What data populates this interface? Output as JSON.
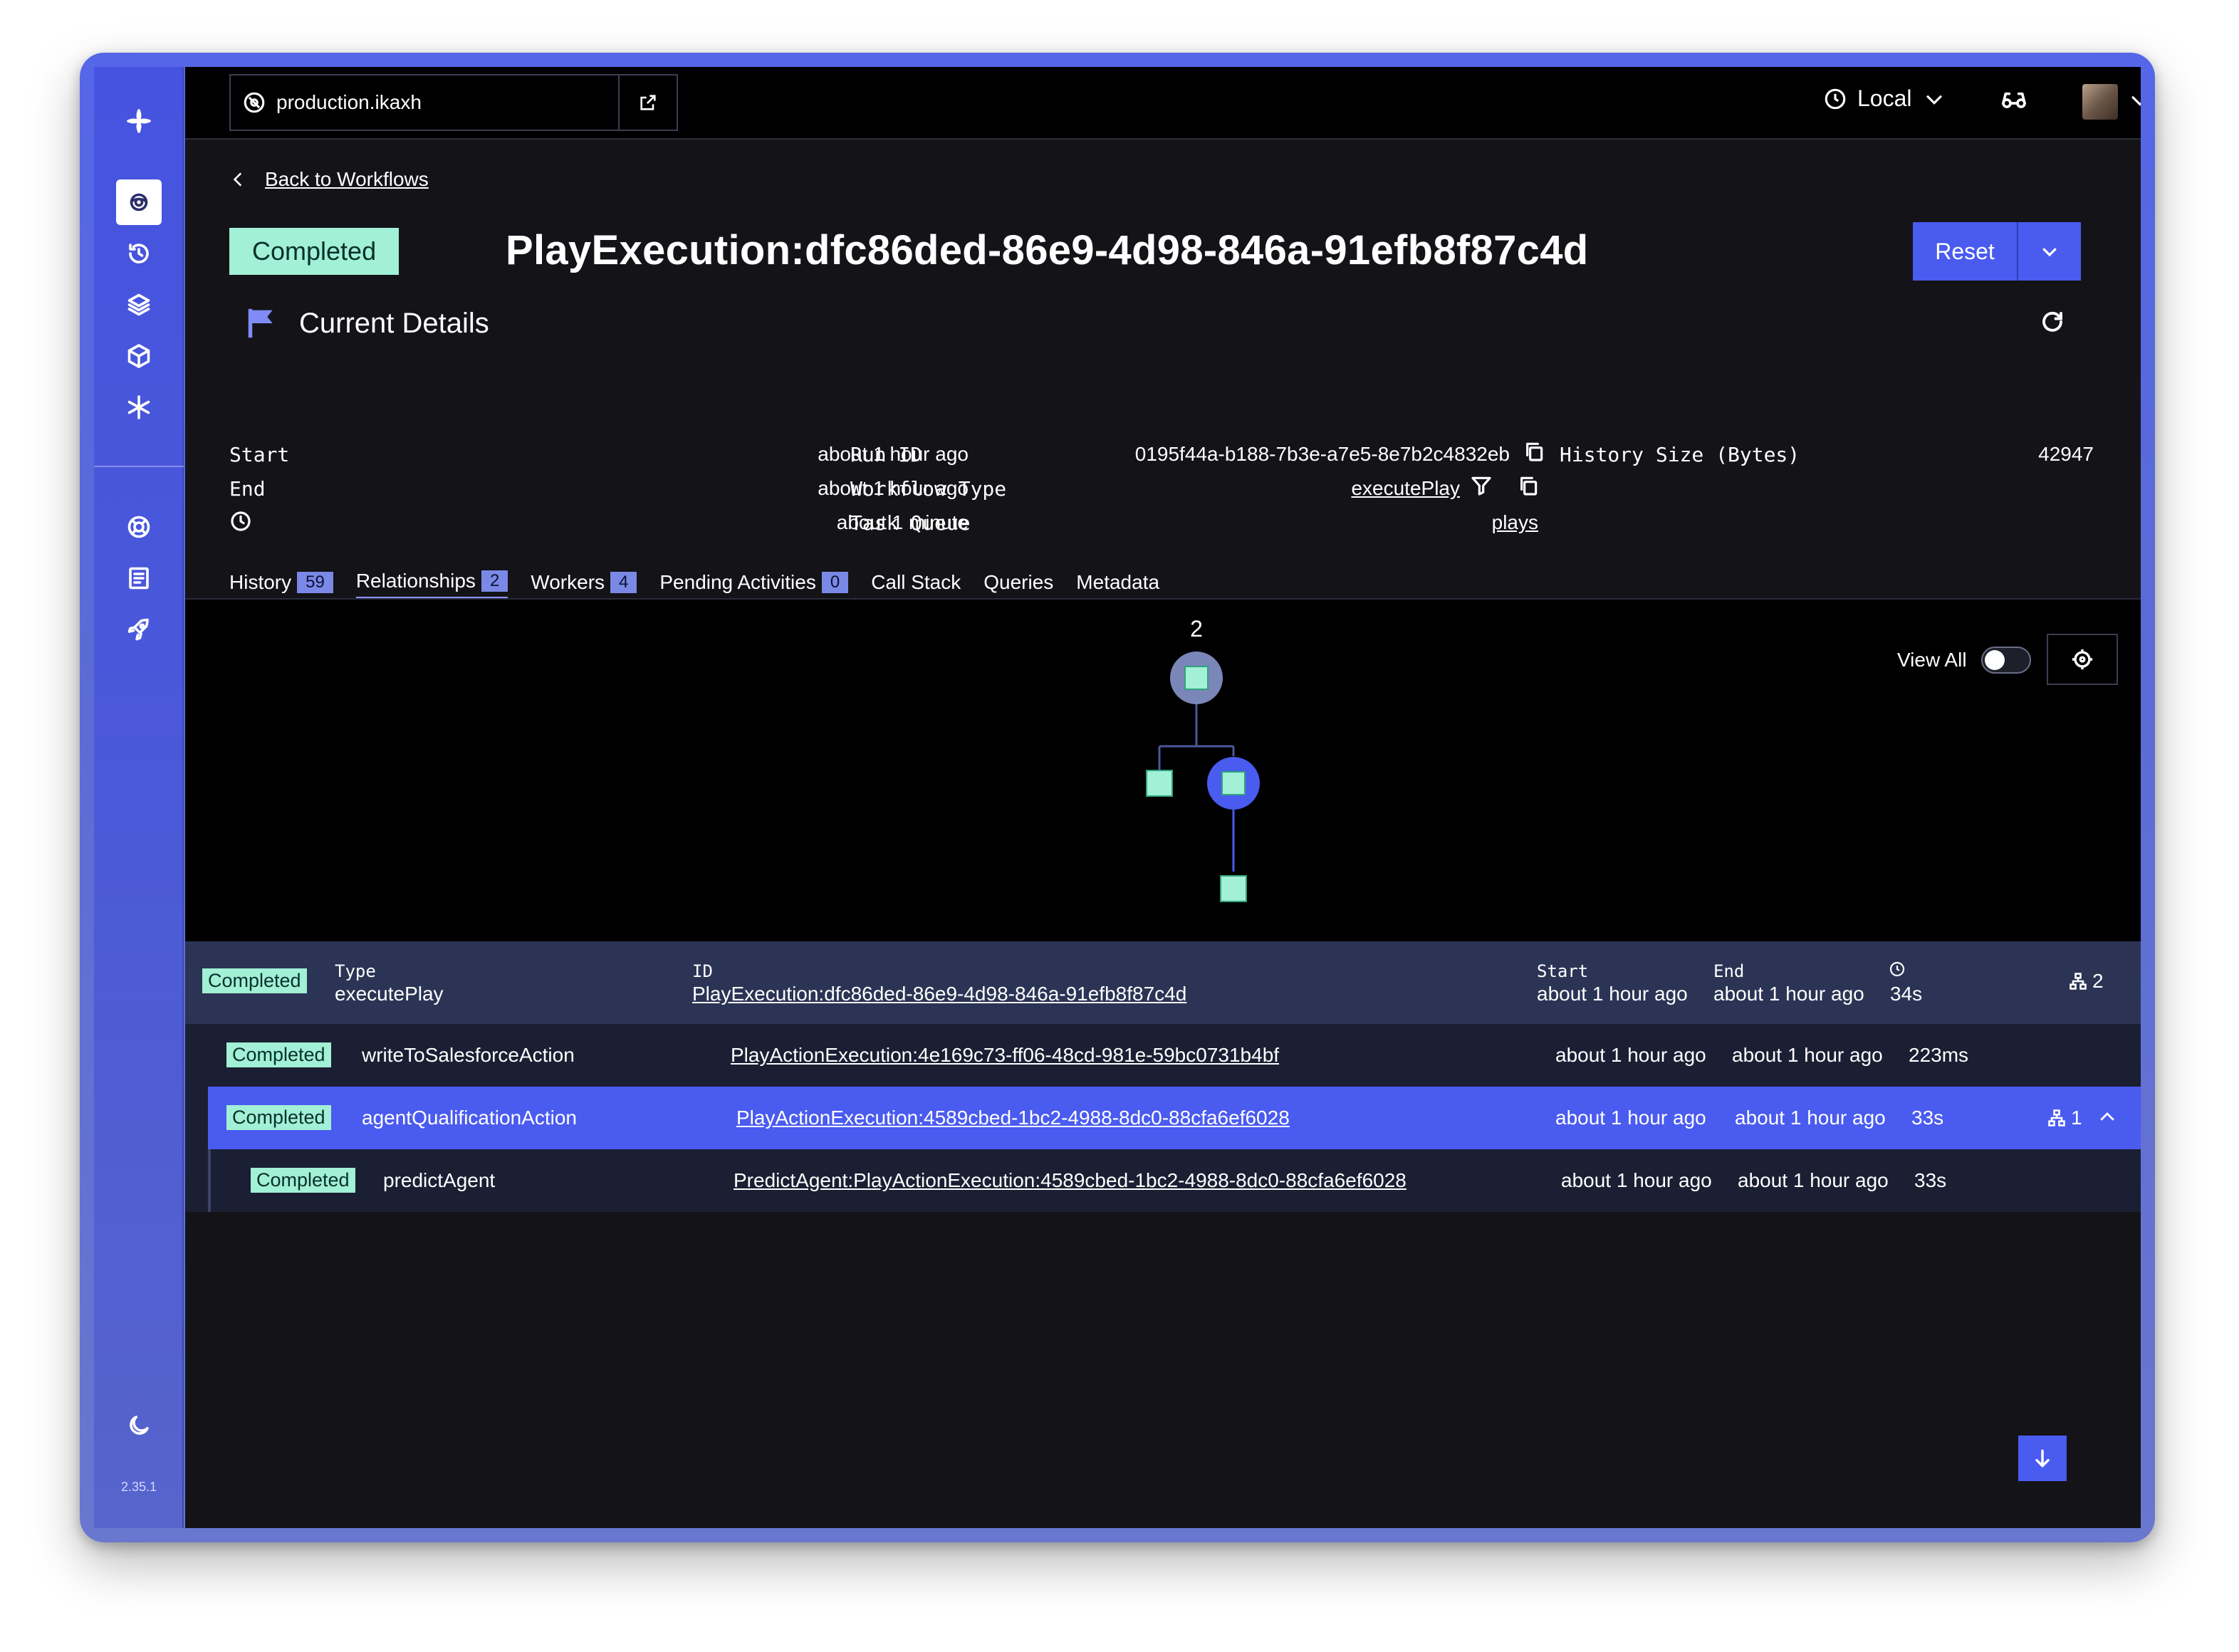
{
  "app": {
    "version": "2.35.1"
  },
  "sidebar": {
    "items": [
      {
        "name": "logo-icon"
      },
      {
        "name": "workflows-icon",
        "active": true
      },
      {
        "name": "schedules-icon"
      },
      {
        "name": "batch-icon"
      },
      {
        "name": "deployments-icon"
      },
      {
        "name": "nexus-icon"
      },
      {
        "name": "support-icon"
      },
      {
        "name": "docs-icon"
      },
      {
        "name": "feedback-icon"
      },
      {
        "name": "theme-moon-icon"
      }
    ]
  },
  "topbar": {
    "namespace": "production.ikaxh",
    "timezone": "Local"
  },
  "header": {
    "back_label": "Back to Workflows",
    "status": "Completed",
    "title": "PlayExecution:dfc86ded-86e9-4d98-846a-91efb8f87c4d",
    "reset_label": "Reset",
    "section_title": "Current Details"
  },
  "details": {
    "start_label": "Start",
    "start_value": "about 1 hour ago",
    "end_label": "End",
    "end_value": "about 1 hour ago",
    "duration_value": "about 1 minute",
    "run_id_label": "Run ID",
    "run_id_value": "0195f44a-b188-7b3e-a7e5-8e7b2c4832eb",
    "workflow_type_label": "Workflow Type",
    "workflow_type_value": "executePlay",
    "task_queue_label": "Task Queue",
    "task_queue_value": "plays",
    "history_size_label": "History Size (Bytes)",
    "history_size_value": "42947"
  },
  "tabs": [
    {
      "label": "History",
      "count": "59"
    },
    {
      "label": "Relationships",
      "count": "2",
      "active": true
    },
    {
      "label": "Workers",
      "count": "4"
    },
    {
      "label": "Pending Activities",
      "count": "0"
    },
    {
      "label": "Call Stack"
    },
    {
      "label": "Queries"
    },
    {
      "label": "Metadata"
    }
  ],
  "graph": {
    "root_label": "2",
    "view_all_label": "View All",
    "view_all_on": false
  },
  "root_row": {
    "status": "Completed",
    "type_label": "Type",
    "type_value": "executePlay",
    "id_label": "ID",
    "id_value": "PlayExecution:dfc86ded-86e9-4d98-846a-91efb8f87c4d",
    "start_label": "Start",
    "start_value": "about 1 hour ago",
    "end_label": "End",
    "end_value": "about 1 hour ago",
    "duration_value": "34s",
    "children_count": "2"
  },
  "children": [
    {
      "status": "Completed",
      "type": "writeToSalesforceAction",
      "id": "PlayActionExecution:4e169c73-ff06-48cd-981e-59bc0731b4bf",
      "start": "about 1 hour ago",
      "end": "about 1 hour ago",
      "duration": "223ms"
    },
    {
      "status": "Completed",
      "type": "agentQualificationAction",
      "id": "PlayActionExecution:4589cbed-1bc2-4988-8dc0-88cfa6ef6028",
      "start": "about 1 hour ago",
      "end": "about 1 hour ago",
      "duration": "33s",
      "children_count": "1"
    },
    {
      "status": "Completed",
      "type": "predictAgent",
      "id": "PredictAgent:PlayActionExecution:4589cbed-1bc2-4988-8dc0-88cfa6ef6028",
      "start": "about 1 hour ago",
      "end": "about 1 hour ago",
      "duration": "33s"
    }
  ],
  "colors": {
    "accent": "#4a5bf0",
    "completed": "#a2f0d6",
    "background": "#141317"
  }
}
